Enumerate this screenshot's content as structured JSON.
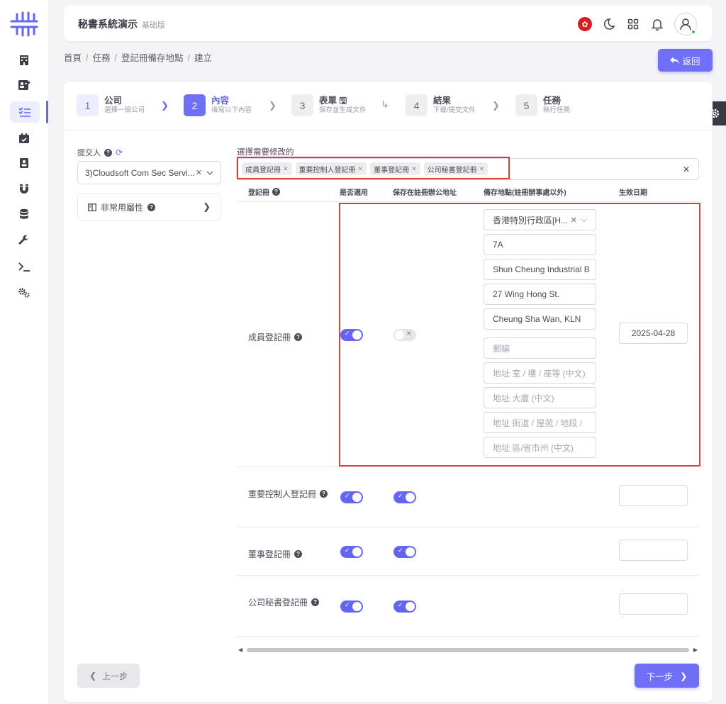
{
  "app": {
    "title": "秘書系統演示",
    "edition": "基础版"
  },
  "nav": {
    "items": [
      {
        "name": "building-icon"
      },
      {
        "name": "contact-card-icon"
      },
      {
        "name": "task-list-icon",
        "active": true
      },
      {
        "name": "calendar-check-icon"
      },
      {
        "name": "address-book-icon"
      },
      {
        "name": "magnet-icon"
      },
      {
        "name": "database-icon"
      },
      {
        "name": "wrench-icon"
      },
      {
        "name": "terminal-icon"
      },
      {
        "name": "gears-icon"
      }
    ]
  },
  "header": {
    "icons": [
      "hk-flag-icon",
      "moon-icon",
      "grid-icon",
      "bell-icon",
      "user-avatar-icon"
    ]
  },
  "breadcrumb": [
    "首頁",
    "任務",
    "登記冊備存地點",
    "建立"
  ],
  "back_label": "返回",
  "steps": [
    {
      "num": "1",
      "title": "公司",
      "sub": "選擇一個公司"
    },
    {
      "num": "2",
      "title": "內容",
      "sub": "填寫以下內容",
      "active": true
    },
    {
      "num": "3",
      "title": "表單",
      "sub": "保存並生成文件"
    },
    {
      "num": "4",
      "title": "結果",
      "sub": "下載/提交文件"
    },
    {
      "num": "5",
      "title": "任務",
      "sub": "執行任務"
    }
  ],
  "submitter": {
    "label": "提交人",
    "value": "3)Cloudsoft Com Sec Servi..."
  },
  "advanced_label": "非常用屬性",
  "select_label": "選擇需要修改的",
  "tags": [
    "成員登記冊",
    "重要控制人登記冊",
    "董事登記冊",
    "公司秘書登記冊"
  ],
  "table": {
    "headers": [
      "登記冊",
      "是否適用",
      "保存在註冊辦公地址",
      "備存地點(註冊辦事處以外)",
      "生效日期"
    ],
    "rows": [
      {
        "name": "成員登記冊",
        "applicable": true,
        "at_registered_office": false,
        "address_fields": [
          {
            "value": "香港特別行政區[H...",
            "placeholder": ""
          },
          {
            "value": "7A",
            "placeholder": ""
          },
          {
            "value": "Shun Cheung Industrial B",
            "placeholder": ""
          },
          {
            "value": "27 Wing Hong St.",
            "placeholder": ""
          },
          {
            "value": "Cheung Sha Wan, KLN",
            "placeholder": ""
          },
          {
            "value": "",
            "placeholder": "郵編"
          },
          {
            "value": "",
            "placeholder": "地址 室 / 樓 / 座等 (中文)"
          },
          {
            "value": "",
            "placeholder": "地址 大廈 (中文)"
          },
          {
            "value": "",
            "placeholder": "地址 街道 / 屋苑 / 地段 /"
          },
          {
            "value": "",
            "placeholder": "地址 區/省市州 (中文)"
          }
        ],
        "effective_date": "2025-04-28"
      },
      {
        "name": "重要控制人登記冊",
        "applicable": true,
        "at_registered_office": true,
        "effective_date": ""
      },
      {
        "name": "董事登記冊",
        "applicable": true,
        "at_registered_office": true,
        "effective_date": ""
      },
      {
        "name": "公司秘書登記冊",
        "applicable": true,
        "at_registered_office": true,
        "effective_date": ""
      }
    ]
  },
  "prev_label": "上一步",
  "next_label": "下一步",
  "colors": {
    "accent": "#6f6ff7",
    "highlight": "#e53935"
  }
}
